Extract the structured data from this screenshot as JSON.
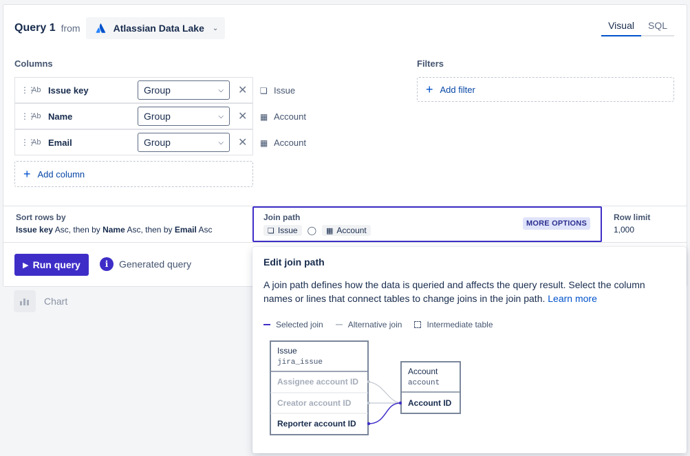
{
  "header": {
    "query_title": "Query 1",
    "from_label": "from",
    "source": "Atlassian Data Lake",
    "tabs": [
      {
        "label": "Visual",
        "active": true
      },
      {
        "label": "SQL",
        "active": false
      }
    ]
  },
  "columns": {
    "label": "Columns",
    "rows": [
      {
        "type": "Ab",
        "name": "Issue key",
        "aggregation": "Group",
        "table": "Issue",
        "table_icon": "jira-icon"
      },
      {
        "type": "Ab",
        "name": "Name",
        "aggregation": "Group",
        "table": "Account",
        "table_icon": "table-icon"
      },
      {
        "type": "Ab",
        "name": "Email",
        "aggregation": "Group",
        "table": "Account",
        "table_icon": "table-icon"
      }
    ],
    "add_label": "Add column"
  },
  "filters": {
    "label": "Filters",
    "add_label": "Add filter"
  },
  "sort": {
    "label": "Sort rows by",
    "parts": [
      "Issue key",
      " Asc, then by ",
      "Name",
      " Asc, then by ",
      "Email",
      " Asc"
    ]
  },
  "join_path": {
    "label": "Join path",
    "from_table": "Issue",
    "to_table": "Account",
    "more_options": "MORE OPTIONS"
  },
  "row_limit": {
    "label": "Row limit",
    "value": "1,000"
  },
  "actions": {
    "run_label": "Run query",
    "generated_label": "Generated query"
  },
  "chart_tab": {
    "label": "Chart"
  },
  "popup": {
    "title": "Edit join path",
    "description": "A join path defines how the data is queried and affects the query result. Select the column names or lines that connect tables to change joins in the join path.",
    "learn_more": "Learn more",
    "legend": {
      "selected": "Selected join",
      "alternative": "Alternative join",
      "intermediate": "Intermediate table"
    },
    "issue_table": {
      "name": "Issue",
      "id": "jira_issue",
      "fields": [
        {
          "label": "Assignee account ID",
          "selected": false
        },
        {
          "label": "Creator account ID",
          "selected": false
        },
        {
          "label": "Reporter account ID",
          "selected": true
        }
      ]
    },
    "account_table": {
      "name": "Account",
      "id": "account",
      "fields": [
        {
          "label": "Account ID",
          "selected": true
        }
      ]
    }
  },
  "colors": {
    "accent": "#3e2ec7",
    "link": "#0052cc",
    "muted": "#a5adba"
  }
}
